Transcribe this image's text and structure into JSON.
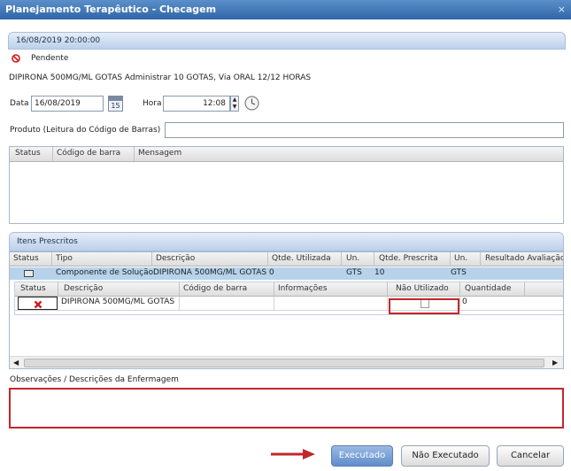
{
  "window": {
    "title": "Planejamento Terapêutico - Checagem",
    "close_glyph": "×"
  },
  "header": {
    "datetime": "16/08/2019 20:00:00",
    "status_text": "Pendente",
    "description": "DIPIRONA 500MG/ML GOTAS Administrar 10 GOTAS, Via ORAL 12/12 HORAS"
  },
  "form": {
    "data_label": "Data",
    "data_value": "16/08/2019",
    "calendar_day": "15",
    "hora_label": "Hora",
    "hora_value": "12:08",
    "produto_label": "Produto (Leitura do Código de Barras)",
    "produto_value": ""
  },
  "scan_grid": {
    "columns": [
      "Status",
      "Código de barra",
      "Mensagem"
    ]
  },
  "itens": {
    "title": "Itens Prescritos",
    "columns": [
      "Status",
      "Tipo",
      "Descrição",
      "Qtde. Utilizada",
      "Un.",
      "Qtde. Prescrita",
      "Un.",
      "Resultado Avaliação"
    ],
    "row": {
      "tipo": "Componente de Solução",
      "descricao": "DIPIRONA 500MG/ML GOTAS",
      "qtde_utilizada": "0",
      "un": "GTS",
      "qtde_prescrita": "10",
      "un2": "GTS"
    },
    "sub_columns": [
      "Status",
      "Descrição",
      "Código de barra",
      "Informações",
      "Não Utilizado",
      "Quantidade"
    ],
    "sub_row": {
      "descricao": "DIPIRONA 500MG/ML GOTAS",
      "codigo": "",
      "informacoes": "",
      "quantidade": "0"
    }
  },
  "observacoes": {
    "label": "Observações / Descrições da Enfermagem",
    "value": ""
  },
  "buttons": {
    "executado": "Executado",
    "nao_executado": "Não Executado",
    "cancelar": "Cancelar"
  },
  "colors": {
    "title_bar": "#2f66a8",
    "highlight_border": "#c0282d",
    "arrow": "#c0282d",
    "status_x": "#d11a1a",
    "selected_row": "#b7d3ec"
  }
}
